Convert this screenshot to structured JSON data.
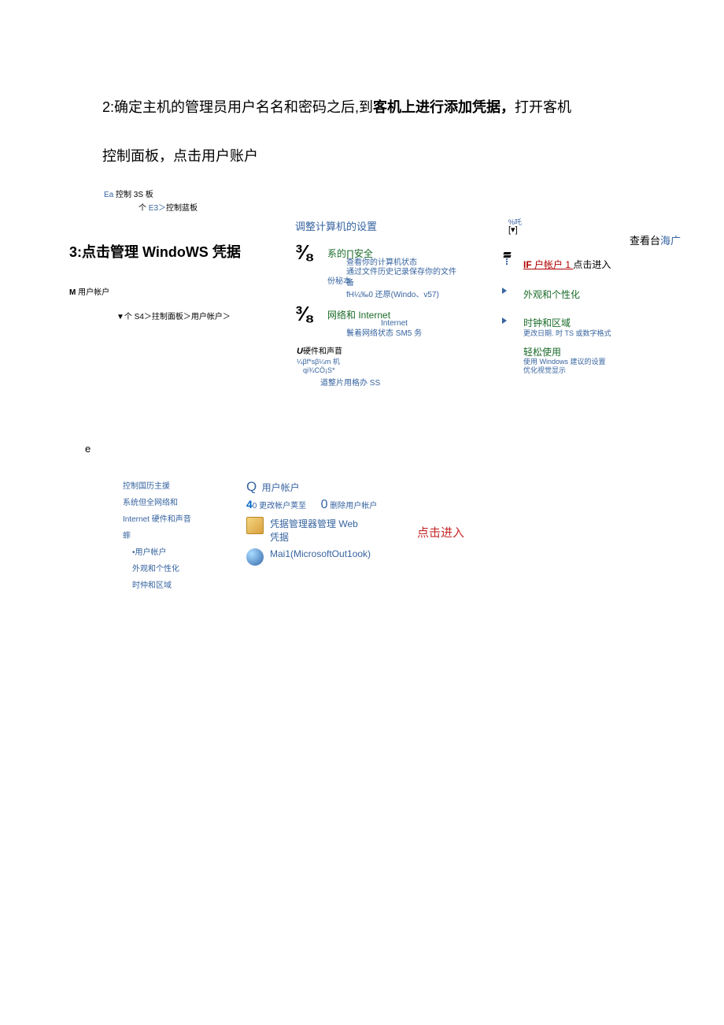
{
  "heading2": {
    "prefix": "2:确定主机的管理员用户名名和密码之后,到",
    "bold": "客机上进行添加凭据，",
    "suffix": "打开客机"
  },
  "heading2b": "控制面板，点击用户账户",
  "crumb1": {
    "ea": "Ea",
    "rest": " 控制 3S 板"
  },
  "crumb2": {
    "prefix": "个 ",
    "e3": "E3＞",
    "rest": "控制蓝板"
  },
  "adjust_title": "调整计算机的设置",
  "view_mode": "%吒",
  "view_mode_arrow": "[▾]",
  "view_label": {
    "pre": "查看台",
    "link": "海广"
  },
  "frac": "⅜",
  "sections": {
    "system": {
      "title": "系的∏安全",
      "l1": "查看你的计算机状态",
      "l2": "通过文件历史记录保存你的文件备",
      "l3": "份秘本",
      "l4": "fH¼‰0 还原(Windo、v57)"
    },
    "network": {
      "title": "网络和 Internet",
      "l1": "Internet",
      "l2": "鬟着网络状态 SM5 务"
    },
    "hardware": {
      "title_prefix": "U",
      "title_text": "硬件和声苜",
      "l1": "¼βf*sβ¼m 机",
      "l2": "qi¾CÖ¡S*",
      "l3": "道整片用格办 SS"
    },
    "user_accounts": {
      "link_if": "IF",
      "link_mid": " 户帐户 1 ",
      "link_suffix": "点击进入"
    },
    "appearance": "外观和个性化",
    "clock": {
      "title": "时钟和区域",
      "sub": "更改日期. 时 TS 或数字格式"
    },
    "ease": {
      "title": "轻松使用",
      "sub1": "使用 Windows 建议的设置",
      "sub2": "优化视觉显示"
    }
  },
  "heading3": "3:点击管理 WindoWS 凭据",
  "m_user": {
    "m": "M ",
    "rest": "用户帐户"
  },
  "e_letter": "e",
  "s3_bread": "▼个 S4＞拄制面板＞用户帐户＞",
  "sidebar": {
    "l1": "控制国历主援",
    "l2": "系统但全网络和",
    "l3": "Internet 硬件和声音",
    "l4": "蟀",
    "l5": "•用户帐户",
    "l6": "外观和个性化",
    "l7": "时仲和区域"
  },
  "main3": {
    "q": "Q",
    "user_acct": " 用户帐户",
    "n40": "4",
    "n40b": "0",
    "change_type": " 更改帐户荚至",
    "n0": "0",
    "remove": " 删除用户帐户",
    "cred_mgr": "凭据管理器管理 Web 凭据",
    "mail": "Mai1(MicrosoftOut1ook)"
  },
  "red_note": "点击进入"
}
